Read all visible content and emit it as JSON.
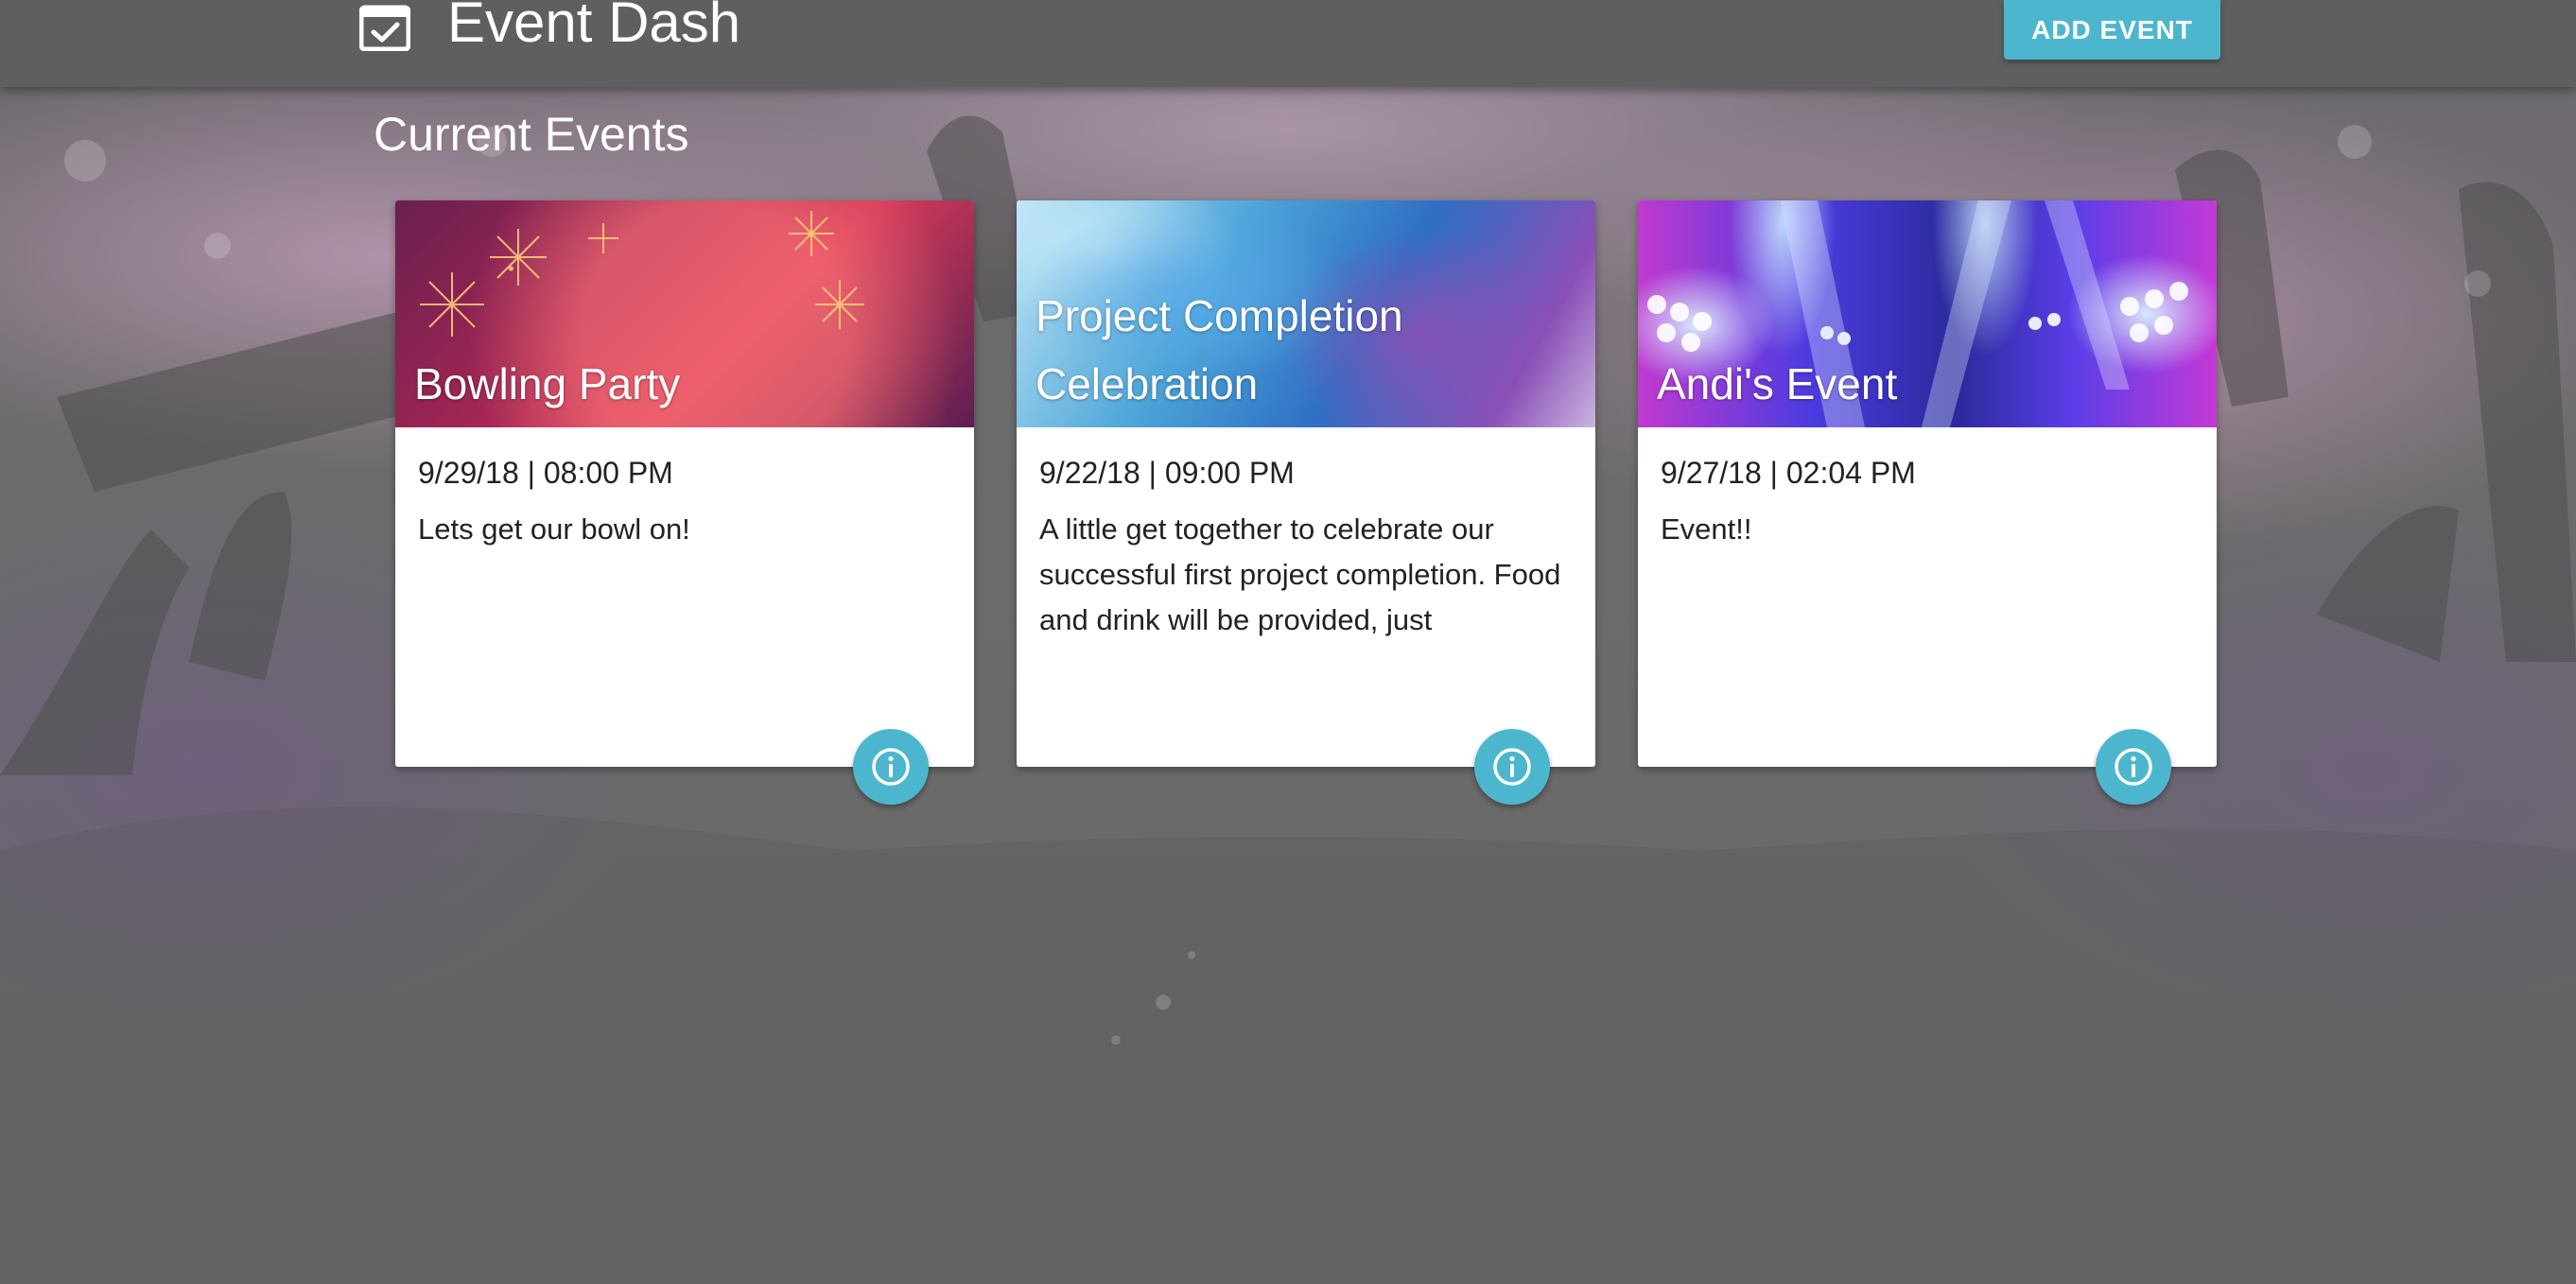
{
  "header": {
    "app_title": "Event Dash",
    "brand_icon": "calendar-check-icon",
    "add_event_label": "ADD EVENT"
  },
  "main": {
    "section_title": "Current Events",
    "events": [
      {
        "title": "Bowling Party",
        "date_time": "9/29/18 | 08:00 PM",
        "description": "Lets get our bowl on!",
        "info_icon": "info-icon"
      },
      {
        "title": "Project Completion Celebration",
        "date_time": "9/22/18 | 09:00 PM",
        "description": "A little get together to celebrate our successful first project completion. Food and drink will be provided, just",
        "info_icon": "info-icon"
      },
      {
        "title": "Andi's Event",
        "date_time": "9/27/18 | 02:04 PM",
        "description": "Event!!",
        "info_icon": "info-icon"
      }
    ]
  },
  "colors": {
    "accent": "#4db6cf",
    "header_bg": "#5f5f5f",
    "card_bg": "#ffffff",
    "text": "#222222"
  }
}
